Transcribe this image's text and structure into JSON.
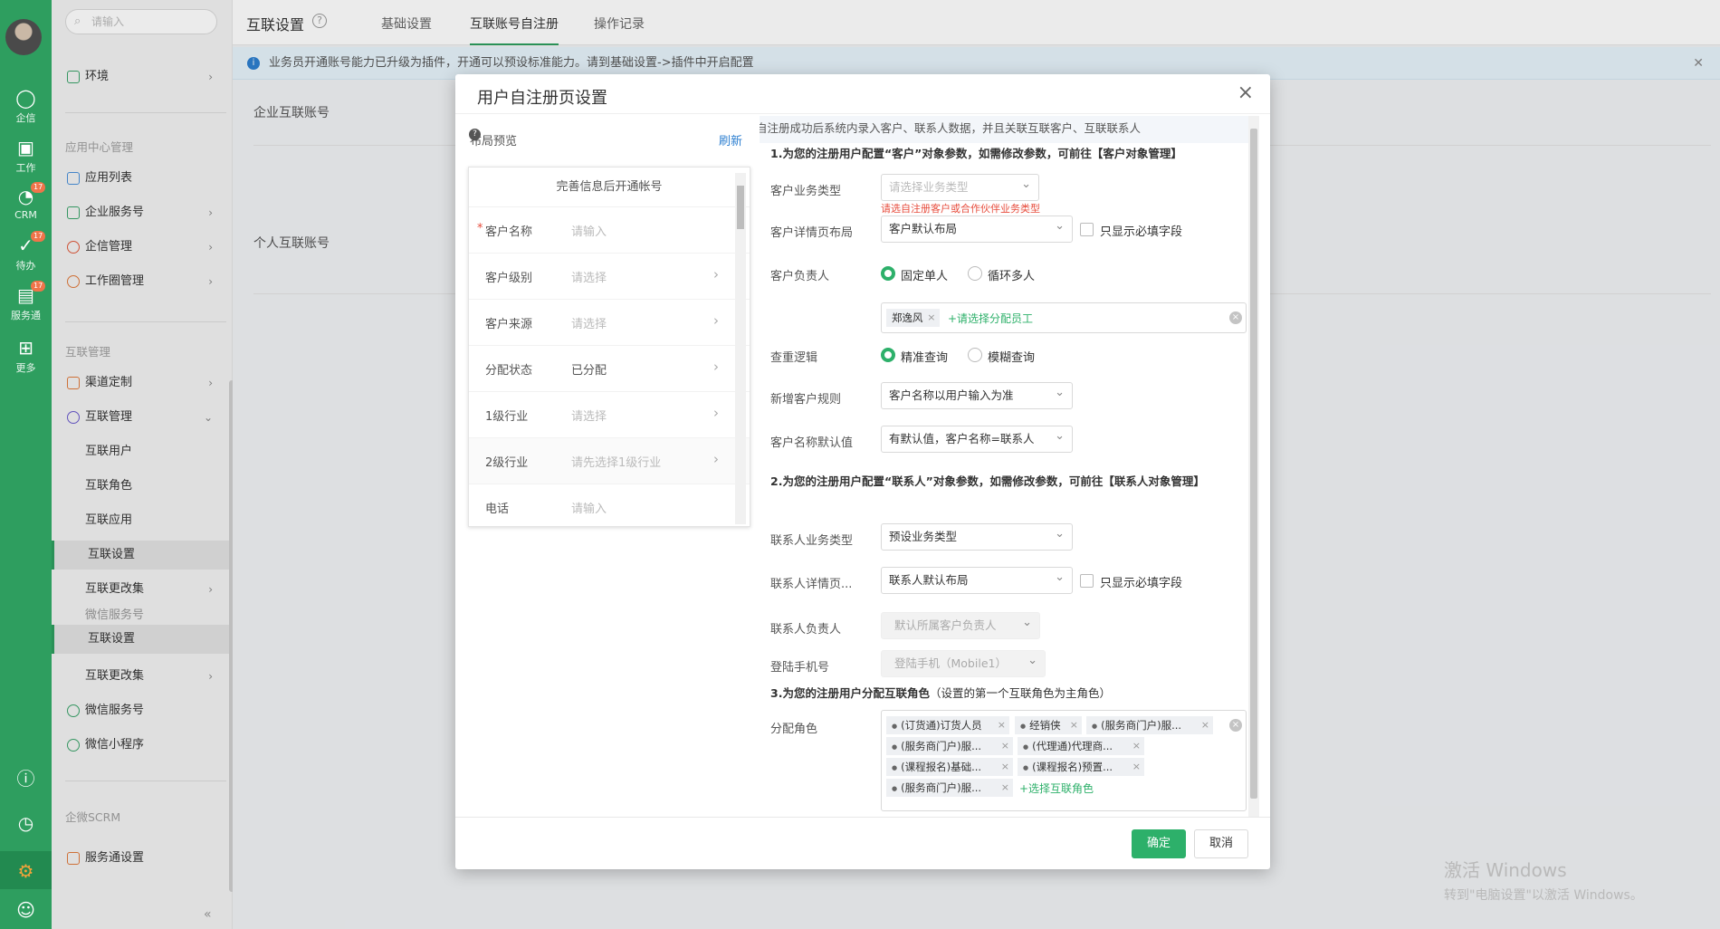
{
  "rail": {
    "items": [
      {
        "label": "企信",
        "icon": "chat-bubble-icon"
      },
      {
        "label": "工作",
        "icon": "briefcase-icon"
      },
      {
        "label": "CRM",
        "icon": "crm-icon",
        "badge": "17"
      },
      {
        "label": "待办",
        "icon": "check-circle-icon",
        "badge": "17"
      },
      {
        "label": "服务通",
        "icon": "service-icon",
        "badge": "17"
      },
      {
        "label": "更多",
        "icon": "grid-icon"
      }
    ]
  },
  "sidebar": {
    "search_placeholder": "请输入",
    "env": "环境",
    "group_app": "应用中心管理",
    "app_list": "应用列表",
    "enterprise_service": "企业服务号",
    "qixin_mgmt": "企信管理",
    "workcircle_mgmt": "工作圈管理",
    "group_interconnect": "互联管理",
    "channel_custom": "渠道定制",
    "interconnect_mgmt": "互联管理",
    "users": "互联用户",
    "roles": "互联角色",
    "apps": "互联应用",
    "settings": "互联设置",
    "changes": "互联更改集",
    "wechat_service_partial": "微信服务号",
    "settings2": "互联设置",
    "changes2": "互联更改集",
    "wechat_service": "微信服务号",
    "wechat_mini": "微信小程序",
    "group_scrm": "企微SCRM",
    "service_settings": "服务通设置"
  },
  "topbar": {
    "title": "互联设置",
    "help": "?",
    "tabs": [
      "基础设置",
      "互联账号自注册",
      "操作记录"
    ]
  },
  "notice": "业务员开通账号能力已升级为插件，开通可以预设标准能力。请到基础设置->插件中开启配置",
  "content": {
    "enterprise_account": "企业互联账号",
    "personal_account": "个人互联账号"
  },
  "watermark": {
    "line1": "激活 Windows",
    "line2": "转到\"电脑设置\"以激活 Windows。"
  },
  "modal": {
    "title": "用户自注册页设置",
    "preview_title": "布局预览",
    "refresh": "刷新",
    "phone_header": "完善信息后开通帐号",
    "phone_rows": [
      {
        "label": "客户名称",
        "value": "请输入",
        "required": true,
        "arrow": false,
        "filled": false
      },
      {
        "label": "客户级别",
        "value": "请选择",
        "required": false,
        "arrow": true,
        "filled": false
      },
      {
        "label": "客户来源",
        "value": "请选择",
        "required": false,
        "arrow": true,
        "filled": false
      },
      {
        "label": "分配状态",
        "value": "已分配",
        "required": false,
        "arrow": true,
        "filled": true
      },
      {
        "label": "1级行业",
        "value": "请选择",
        "required": false,
        "arrow": true,
        "filled": false
      },
      {
        "label": "2级行业",
        "value": "请先选择1级行业",
        "required": false,
        "arrow": true,
        "filled": false
      },
      {
        "label": "电话",
        "value": "请输入",
        "required": false,
        "arrow": false,
        "filled": false
      }
    ],
    "banner": "自注册成功后系统内录入客户、联系人数据，并且关联互联客户、互联联系人",
    "section1": "1.为您的注册用户配置“客户”对象参数，如需修改参数，可前往【客户对象管理】",
    "cust_type_label": "客户业务类型",
    "cust_type_placeholder": "请选择业务类型",
    "cust_type_error": "请选自注册客户或合作伙伴业务类型",
    "cust_layout_label": "客户详情页布局",
    "cust_layout_value": "客户默认布局",
    "required_only": "只显示必填字段",
    "cust_owner_label": "客户负责人",
    "owner_opt1": "固定单人",
    "owner_opt2": "循环多人",
    "owner_tag": "郑逸风",
    "add_staff": "+请选择分配员工",
    "dedup_label": "查重逻辑",
    "dedup_opt1": "精准查询",
    "dedup_opt2": "模糊查询",
    "new_rule_label": "新增客户规则",
    "new_rule_value": "客户名称以用户输入为准",
    "default_name_label": "客户名称默认值",
    "default_name_value": "有默认值，客户名称=联系人",
    "section2": "2.为您的注册用户配置“联系人”对象参数，如需修改参数，可前往【联系人对象管理】",
    "contact_type_label": "联系人业务类型",
    "contact_type_value": "预设业务类型",
    "contact_layout_label": "联系人详情页...",
    "contact_layout_value": "联系人默认布局",
    "required_only2": "只显示必填字段",
    "contact_owner_label": "联系人负责人",
    "contact_owner_value": "默认所属客户负责人",
    "login_phone_label": "登陆手机号",
    "login_phone_value": "登陆手机（Mobile1）",
    "section3": "3.为您的注册用户分配互联角色",
    "section3_note": "（设置的第一个互联角色为主角色）",
    "role_label": "分配角色",
    "roles": [
      "(订货通)订货人员",
      "经销侠",
      "(服务商门户)服...",
      "(服务商门户)服...",
      "(代理通)代理商...",
      "(课程报名)基础...",
      "(课程报名)预置...",
      "(服务商门户)服..."
    ],
    "add_role": "+选择互联角色",
    "ok": "确定",
    "cancel": "取消"
  }
}
